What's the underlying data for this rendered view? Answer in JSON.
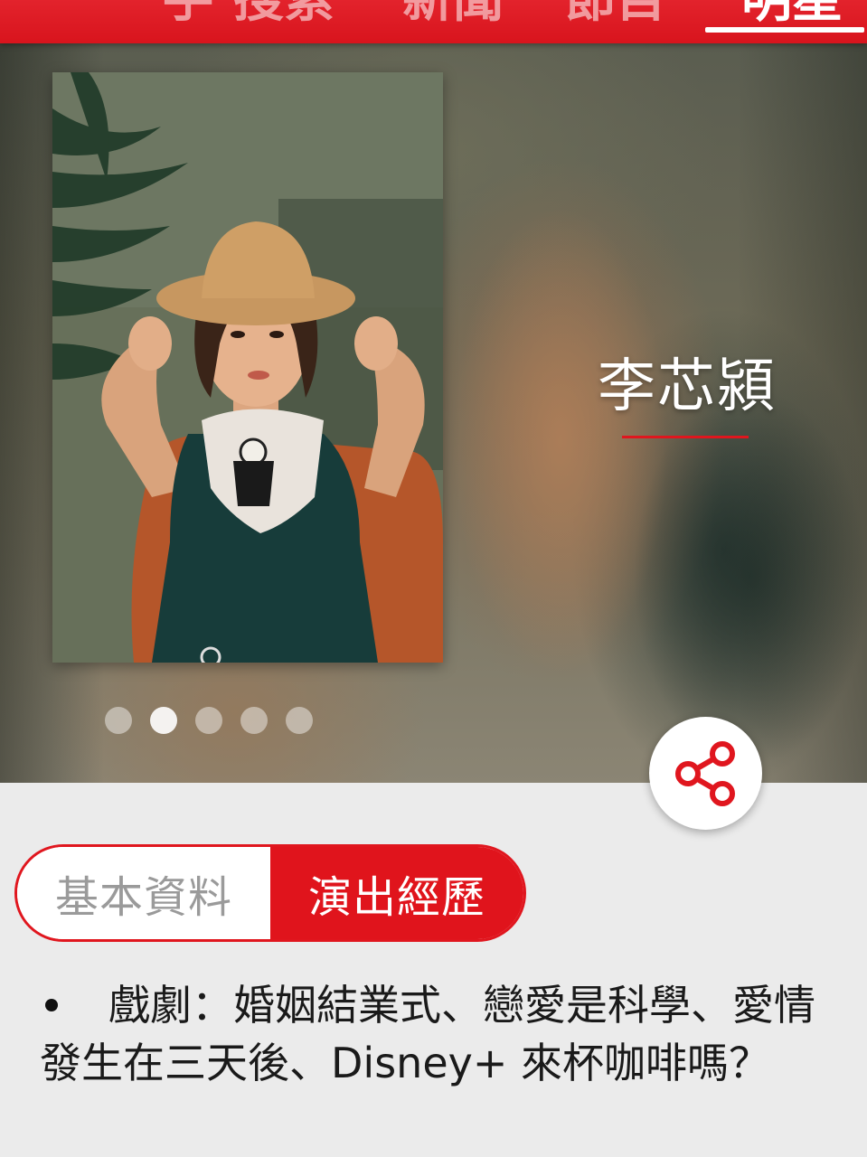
{
  "nav": {
    "tabs": [
      {
        "label": "手"
      },
      {
        "label": "搜索"
      },
      {
        "label": "新聞"
      },
      {
        "label": "節目"
      },
      {
        "label": "明星"
      }
    ],
    "active_index": 4,
    "accent_color": "#e0161e"
  },
  "hero": {
    "photo_alt": "李芯潁",
    "carousel": {
      "count": 5,
      "active_index": 1
    },
    "name": "李芯潁",
    "share_icon": "share-icon"
  },
  "segment": {
    "basic_info_label": "基本資料",
    "experience_label": "演出經歷",
    "active": "experience"
  },
  "content": {
    "items": [
      {
        "text": "戲劇：婚姻結業式、戀愛是科學、愛情發生在三天後、Disney+ 來杯咖啡嗎？"
      }
    ]
  }
}
